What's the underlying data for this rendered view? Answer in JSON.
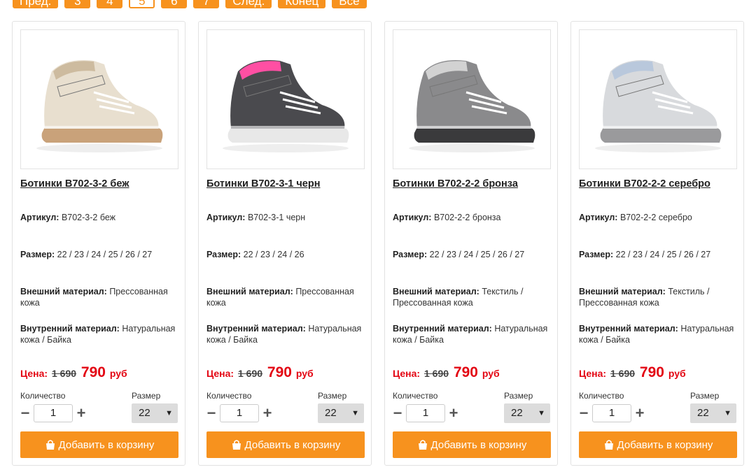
{
  "pagination": [
    {
      "label": "Пред.",
      "current": false
    },
    {
      "label": "3",
      "current": false
    },
    {
      "label": "4",
      "current": false
    },
    {
      "label": "5",
      "current": true
    },
    {
      "label": "6",
      "current": false
    },
    {
      "label": "7",
      "current": false
    },
    {
      "label": "След.",
      "current": false
    },
    {
      "label": "Конец",
      "current": false
    },
    {
      "label": "Все",
      "current": false
    }
  ],
  "labels": {
    "article": "Артикул:",
    "size": "Размер:",
    "outer": "Внешний материал:",
    "inner": "Внутренний материал:",
    "price": "Цена:",
    "currency": "руб",
    "quantity": "Количество",
    "size_select": "Размер",
    "add_to_cart": "Добавить в корзину"
  },
  "colors": {
    "accent": "#f7921e",
    "price_red": "#e30613"
  },
  "products": [
    {
      "title": "Ботинки В702-3-2 беж",
      "article": "В702-3-2 беж",
      "sizes": "22 / 23 / 24 / 25 / 26 / 27",
      "outer": "Прессованная кожа",
      "inner": "Натуральная кожа / Байка",
      "old_price": "1 690",
      "new_price": "790",
      "qty": "1",
      "size": "22",
      "shoe_color": "#e8dfcf",
      "accent_color": "#cdbb9f",
      "sole_color": "#c9a27a"
    },
    {
      "title": "Ботинки В702-3-1 черн",
      "article": "В702-3-1 черн",
      "sizes": "22 / 23 / 24 / 26",
      "outer": "Прессованная кожа",
      "inner": "Натуральная кожа / Байка",
      "old_price": "1 690",
      "new_price": "790",
      "qty": "1",
      "size": "22",
      "shoe_color": "#4a4a4e",
      "accent_color": "#ff4fa3",
      "sole_color": "#e8e8e8"
    },
    {
      "title": "Ботинки В702-2-2 бронза",
      "article": "В702-2-2 бронза",
      "sizes": "22 / 23 / 24 / 25 / 26 / 27",
      "outer": "Текстиль / Прессованная кожа",
      "inner": "Натуральная кожа / Байка",
      "old_price": "1 690",
      "new_price": "790",
      "qty": "1",
      "size": "22",
      "shoe_color": "#8a8a8c",
      "accent_color": "#d2d2d2",
      "sole_color": "#3a3a3c"
    },
    {
      "title": "Ботинки В702-2-2 серебро",
      "article": "В702-2-2 серебро",
      "sizes": "22 / 23 / 24 / 25 / 26 / 27",
      "outer": "Текстиль / Прессованная кожа",
      "inner": "Натуральная кожа / Байка",
      "old_price": "1 690",
      "new_price": "790",
      "qty": "1",
      "size": "22",
      "shoe_color": "#d8dadd",
      "accent_color": "#b9c8dc",
      "sole_color": "#9a9a9c"
    }
  ]
}
